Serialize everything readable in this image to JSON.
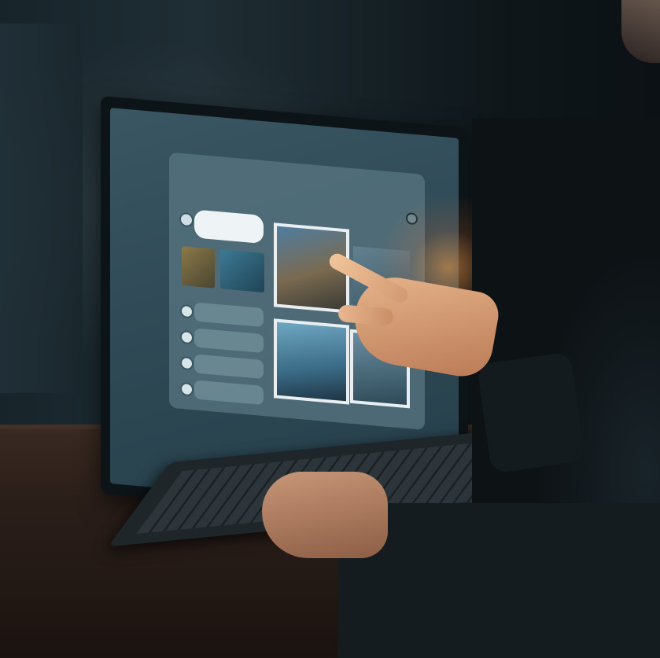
{
  "screen_app": {
    "title": "",
    "heading": "",
    "profile": {
      "line1": "",
      "line2": "",
      "right1": "",
      "right2": ""
    },
    "thumb_caption": "",
    "list_items": [
      {
        "label": ""
      },
      {
        "label": ""
      },
      {
        "label": ""
      },
      {
        "label": ""
      }
    ],
    "footer": ""
  },
  "colors": {
    "screen": "#2c4652",
    "app_panel": "#587682",
    "glow": "#ffa046",
    "desk": "#2a1e19"
  },
  "icons": [
    "close-circle-icon",
    "avatar-circle-icon",
    "list-circle-icon"
  ]
}
